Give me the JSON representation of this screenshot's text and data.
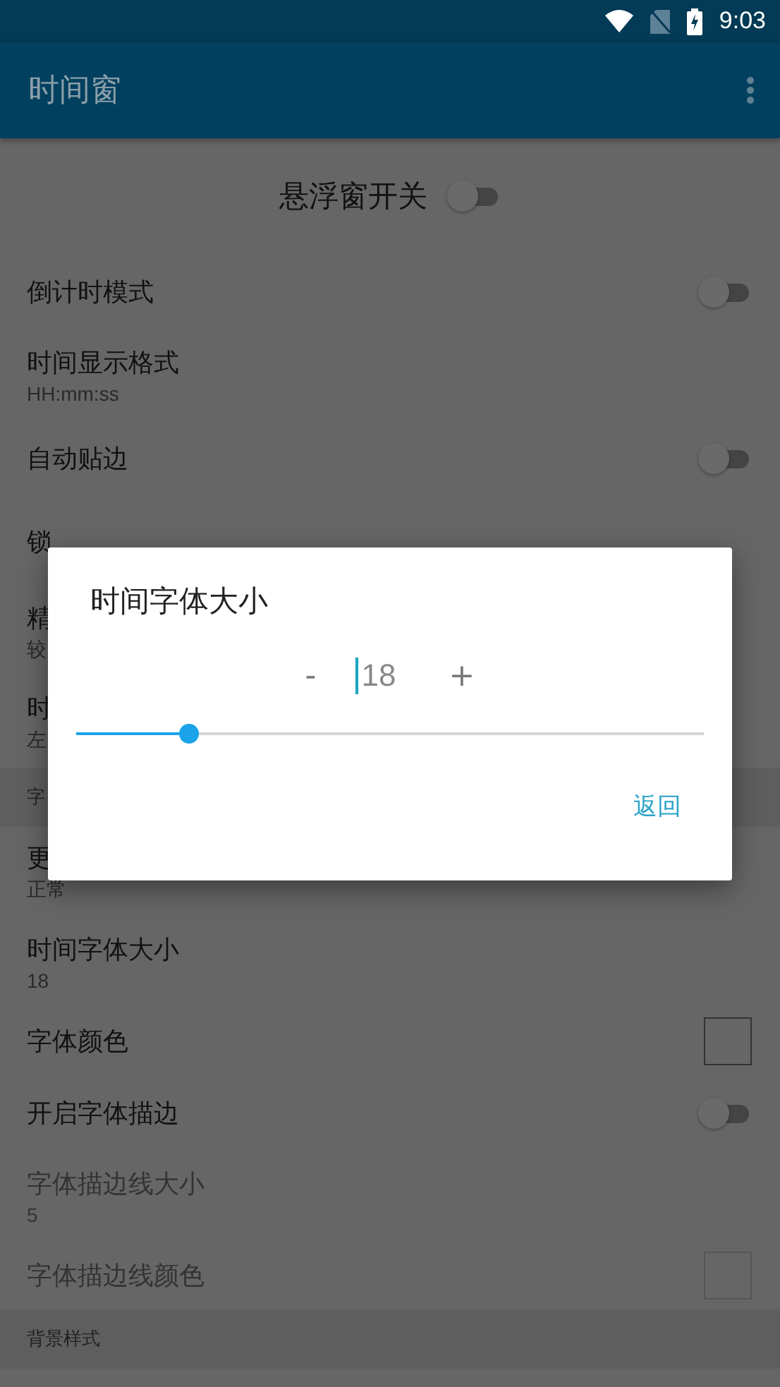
{
  "status_bar": {
    "time": "9:03"
  },
  "app_bar": {
    "title": "时间窗"
  },
  "master_switch": {
    "label": "悬浮窗开关",
    "on": false
  },
  "settings": [
    {
      "kind": "toggle",
      "title": "倒计时模式",
      "on": false,
      "disabled": false
    },
    {
      "kind": "text",
      "title": "时间显示格式",
      "summary": "HH:mm:ss",
      "disabled": false
    },
    {
      "kind": "toggle",
      "title": "自动贴边",
      "on": false,
      "disabled": false
    },
    {
      "kind": "text",
      "title": "锁",
      "disabled": false
    },
    {
      "kind": "text",
      "title": "精",
      "summary": "较",
      "disabled": false
    },
    {
      "kind": "text",
      "title": "时",
      "summary": "左",
      "disabled": false
    },
    {
      "kind": "header",
      "title": "字",
      "disabled": false
    },
    {
      "kind": "text",
      "title": "更",
      "summary": "正常",
      "disabled": false
    },
    {
      "kind": "text",
      "title": "时间字体大小",
      "summary": "18",
      "disabled": false
    },
    {
      "kind": "color",
      "title": "字体颜色",
      "disabled": false
    },
    {
      "kind": "toggle",
      "title": "开启字体描边",
      "on": false,
      "disabled": false
    },
    {
      "kind": "text",
      "title": "字体描边线大小",
      "summary": "5",
      "disabled": true
    },
    {
      "kind": "color",
      "title": "字体描边线颜色",
      "disabled": true
    },
    {
      "kind": "header",
      "title": "背景样式",
      "disabled": false
    }
  ],
  "dialog": {
    "title": "时间字体大小",
    "decrement": "-",
    "value": "18",
    "increment": "+",
    "slider": {
      "level": 0.18
    },
    "button": "返回"
  }
}
